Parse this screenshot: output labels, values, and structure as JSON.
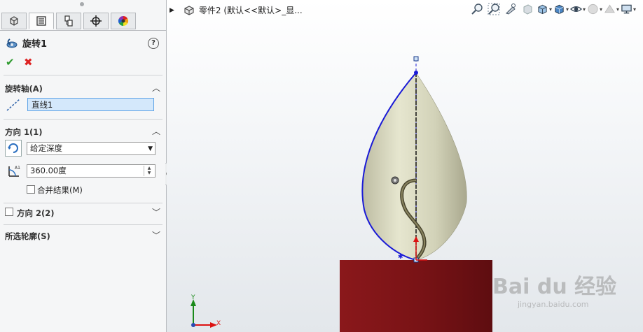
{
  "property_manager": {
    "tabs": [
      {
        "name": "feature-manager",
        "icon": "feature-tree-icon"
      },
      {
        "name": "property-manager",
        "icon": "property-manager-icon"
      },
      {
        "name": "configuration-manager",
        "icon": "configuration-icon"
      },
      {
        "name": "dimxpert-manager",
        "icon": "crosshair-icon"
      },
      {
        "name": "display-manager",
        "icon": "color-wheel-icon"
      }
    ],
    "feature_title": "旋转1",
    "help": "?",
    "ok_symbol": "✔",
    "cancel_symbol": "✖",
    "axis_section": {
      "title": "旋转轴(A)",
      "axis_value": "直线1"
    },
    "direction1": {
      "title": "方向 1(1)",
      "end_condition": "给定深度",
      "angle": "360.00度",
      "merge_label": "合并结果(M)",
      "merge_checked": false
    },
    "direction2": {
      "title": "方向 2(2)",
      "checked": false
    },
    "selected_contours": {
      "title": "所选轮廓(S)"
    }
  },
  "viewport": {
    "breadcrumb": "零件2 (默认<<默认>_显...",
    "toolbar_icons": [
      "zoom-to-fit-icon",
      "zoom-area-icon",
      "previous-view-icon",
      "section-view-icon",
      "view-orientation-icon",
      "display-style-icon",
      "hide-show-icon",
      "edit-appearance-icon",
      "apply-scene-icon",
      "view-settings-icon"
    ],
    "triad": {
      "x_label": "X",
      "y_label": "Y"
    },
    "watermark": {
      "line1": "Bai du 经验",
      "line2": "jingyan.baidu.com"
    },
    "colors": {
      "shell": "#d8d8c0",
      "profile": "#1a1ad6",
      "base": "#7a1316",
      "axis_x": "#d11",
      "axis_y": "#1a8a1a"
    }
  }
}
